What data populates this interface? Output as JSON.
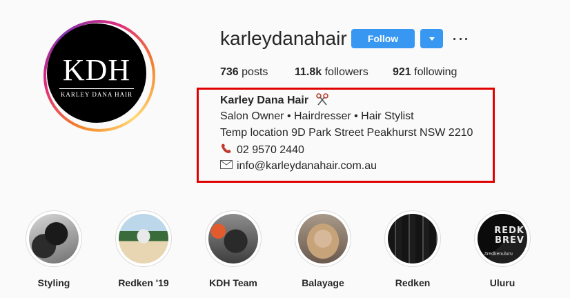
{
  "profile": {
    "avatar_logo_main": "KDH",
    "avatar_logo_sub": "KARLEY DANA HAIR",
    "username": "karleydanahair",
    "follow_label": "Follow"
  },
  "stats": {
    "posts_count": "736",
    "posts_label": "posts",
    "followers_count": "11.8k",
    "followers_label": "followers",
    "following_count": "921",
    "following_label": "following"
  },
  "bio": {
    "name": "Karley Dana Hair",
    "line1": "Salon Owner • Hairdresser • Hair Stylist",
    "line2": "Temp location 9D Park Street Peakhurst NSW 2210",
    "phone": "02 9570 2440",
    "email": "info@karleydanahair.com.au"
  },
  "highlights": [
    {
      "label": "Styling"
    },
    {
      "label": "Redken '19"
    },
    {
      "label": "KDH Team"
    },
    {
      "label": "Balayage"
    },
    {
      "label": "Redken"
    },
    {
      "label": "Uluru",
      "overlay_text": "REDK\nBREV",
      "overlay_small": "#redkenuluru"
    }
  ],
  "colors": {
    "accent": "#3897f0",
    "highlight_box": "#e00000",
    "text": "#262626",
    "background": "#fafafa"
  },
  "icons": [
    "scissors-icon",
    "phone-icon",
    "envelope-icon",
    "caret-down-icon",
    "more-options-icon"
  ]
}
